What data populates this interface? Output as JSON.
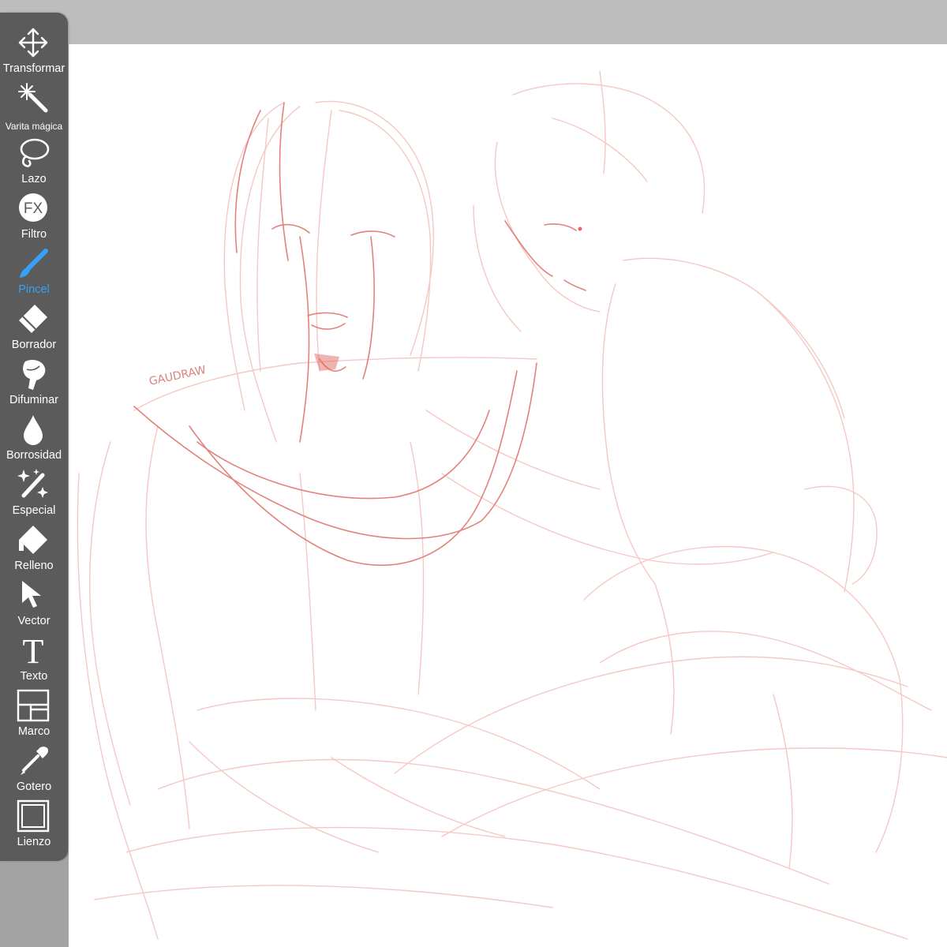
{
  "toolbar": {
    "tools": [
      {
        "label": "Transformar",
        "icon": "move-arrows-icon",
        "active": false
      },
      {
        "label": "Varita mágica",
        "icon": "magic-wand-icon",
        "active": false
      },
      {
        "label": "Lazo",
        "icon": "lasso-icon",
        "active": false
      },
      {
        "label": "Filtro",
        "icon": "fx-icon",
        "active": false
      },
      {
        "label": "Pincel",
        "icon": "brush-icon",
        "active": true
      },
      {
        "label": "Borrador",
        "icon": "eraser-icon",
        "active": false
      },
      {
        "label": "Difuminar",
        "icon": "smudge-finger-icon",
        "active": false
      },
      {
        "label": "Borrosidad",
        "icon": "blur-drop-icon",
        "active": false
      },
      {
        "label": "Especial",
        "icon": "special-sparkle-icon",
        "active": false
      },
      {
        "label": "Relleno",
        "icon": "fill-bucket-icon",
        "active": false
      },
      {
        "label": "Vector",
        "icon": "vector-cursor-icon",
        "active": false
      },
      {
        "label": "Texto",
        "icon": "text-icon",
        "active": false
      },
      {
        "label": "Marco",
        "icon": "frame-icon",
        "active": false
      },
      {
        "label": "Gotero",
        "icon": "eyedropper-icon",
        "active": false
      },
      {
        "label": "Lienzo",
        "icon": "canvas-icon",
        "active": false
      }
    ],
    "fx_glyph": "FX",
    "text_glyph": "T"
  },
  "canvas": {
    "signature": "GAUDRAW",
    "colors": {
      "sketch": "#f2b8b3",
      "ink": "#e06a62",
      "active_tool": "#35a0f5"
    }
  }
}
